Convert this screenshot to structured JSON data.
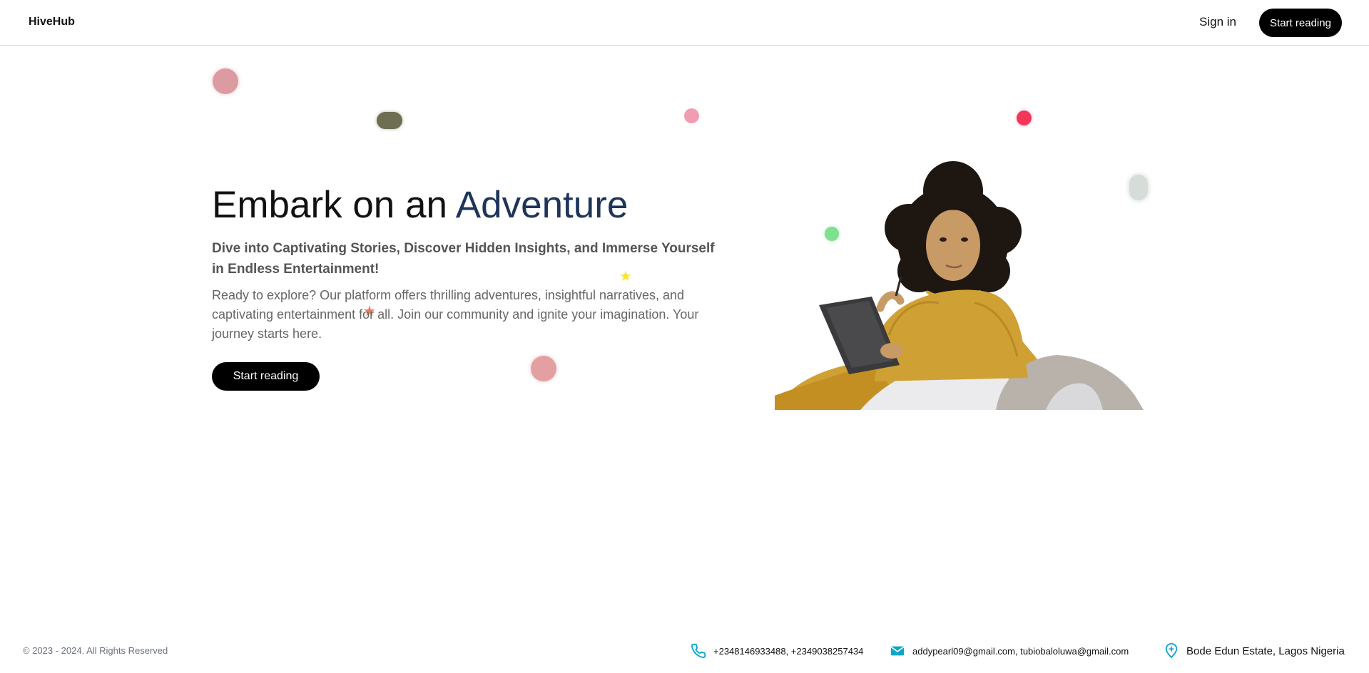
{
  "nav": {
    "brand": "HiveHub",
    "sign_in": "Sign in",
    "start_reading": "Start reading"
  },
  "hero": {
    "title_prefix": "Embark on an",
    "title_accent": "Adventure",
    "subtitle": "Dive into Captivating Stories, Discover Hidden Insights, and Immerse Yourself in Endless Entertainment!",
    "description": "Ready to explore? Our platform offers thrilling adventures, insightful narratives, and captivating entertainment for all. Join our community and ignite your imagination. Your journey starts here.",
    "cta": "Start reading"
  },
  "footer": {
    "copyright": "© 2023 - 2024. All Rights Reserved",
    "phone": "+2348146933488, +2349038257434",
    "email": "addypearl09@gmail.com, tubiobaloluwa@gmail.com",
    "location": "Bode Edun Estate, Lagos Nigeria"
  },
  "colors": {
    "accent": "#1e3558",
    "button": "#000000",
    "icon": "#0ea5c9"
  },
  "icons": [
    "phone-icon",
    "email-icon",
    "location-pin-icon"
  ]
}
